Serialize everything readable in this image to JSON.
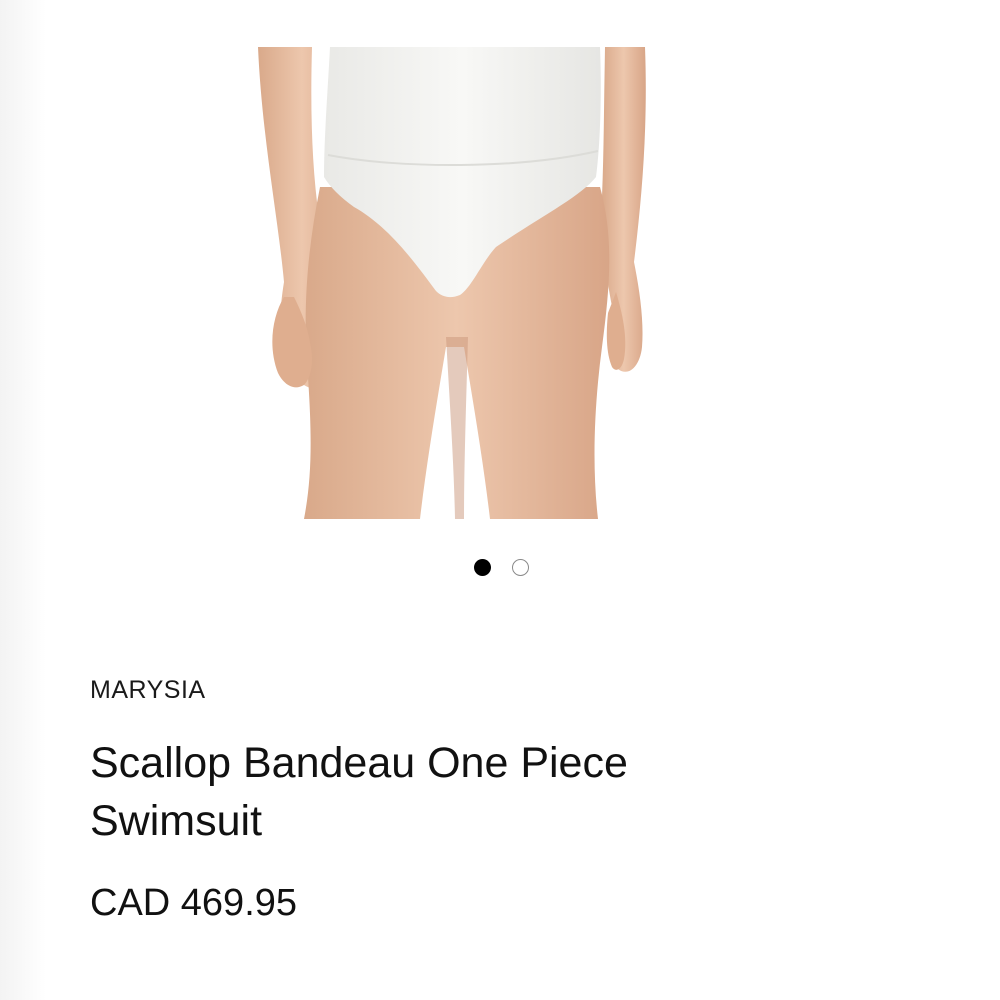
{
  "product": {
    "brand": "MARYSIA",
    "title": "Scallop Bandeau One Piece Swimsuit",
    "price": "CAD 469.95"
  },
  "carousel": {
    "total_slides": 2,
    "active_index": 0,
    "dot_active_color": "#000000",
    "dot_inactive_border_color": "#8a8a8a"
  },
  "colors": {
    "background": "#ffffff",
    "text": "#111111",
    "swimsuit": "#f4f4f2",
    "skin": "#e2b99c"
  }
}
